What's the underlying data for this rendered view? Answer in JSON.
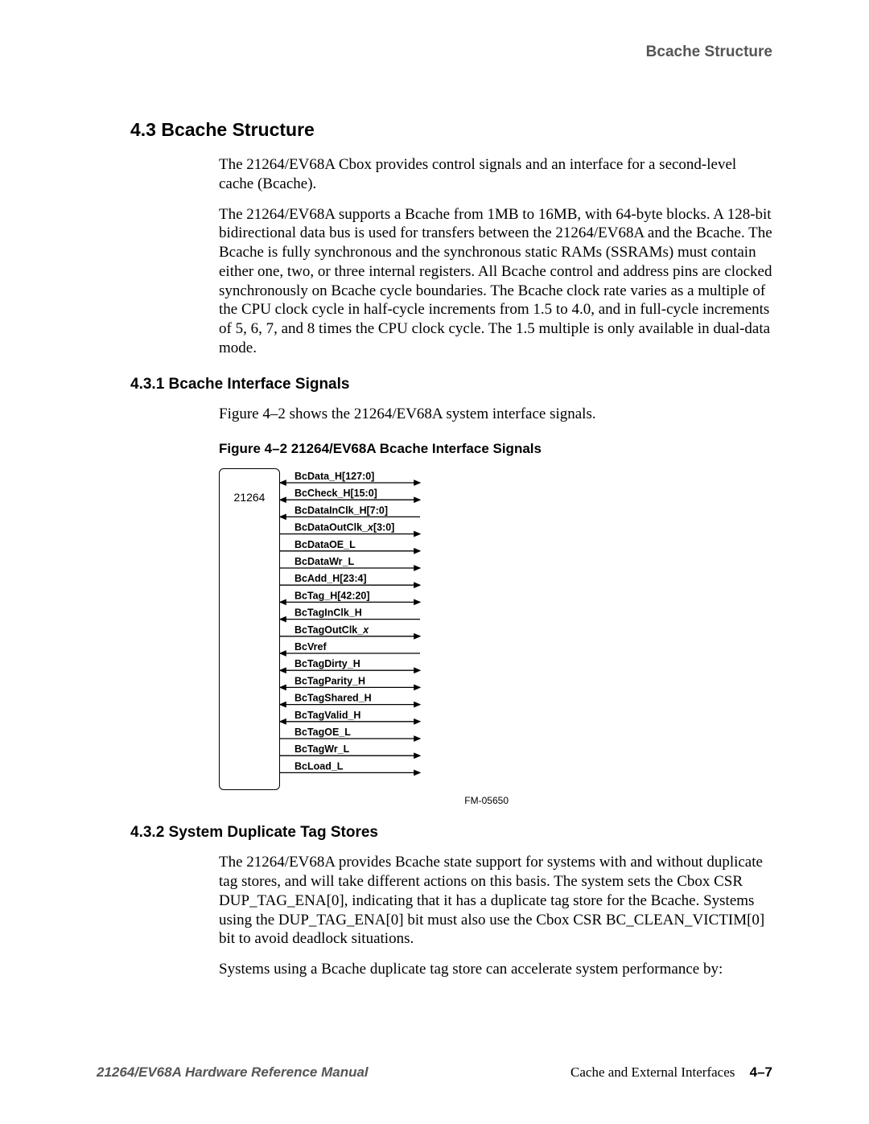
{
  "running_head": "Bcache Structure",
  "section": {
    "number_title": "4.3  Bcache Structure",
    "p1": "The 21264/EV68A Cbox provides control signals and an interface for a second-level cache (Bcache).",
    "p2": "The 21264/EV68A supports a Bcache from 1MB to 16MB, with 64-byte blocks. A 128-bit bidirectional data bus is used for transfers between the 21264/EV68A and the Bcache. The Bcache is fully synchronous and the synchronous static RAMs (SSRAMs) must contain either one, two, or three internal registers. All Bcache control and address pins are clocked synchronously on Bcache cycle boundaries. The Bcache clock rate varies as a multiple of the CPU clock cycle in half-cycle increments from 1.5 to 4.0, and in full-cycle increments of 5, 6, 7, and 8 times the CPU clock cycle. The 1.5 multiple is only available in dual-data mode."
  },
  "sub1": {
    "number_title": "4.3.1  Bcache Interface Signals",
    "p1": "Figure 4–2 shows the 21264/EV68A system interface signals.",
    "fig_caption": "Figure 4–2  21264/EV68A Bcache Interface Signals"
  },
  "figure": {
    "chip_label": "21264",
    "fm_code": "FM-05650",
    "signals": [
      {
        "name": "BcData_H[127:0]",
        "left": true,
        "right": true
      },
      {
        "name": "BcCheck_H[15:0]",
        "left": true,
        "right": true
      },
      {
        "name": "BcDataInClk_H[7:0]",
        "left": true,
        "right": false
      },
      {
        "name": "BcDataOutClk_x[3:0]",
        "left": false,
        "right": true
      },
      {
        "name": "BcDataOE_L",
        "left": false,
        "right": true
      },
      {
        "name": "BcDataWr_L",
        "left": false,
        "right": true
      },
      {
        "name": "BcAdd_H[23:4]",
        "left": false,
        "right": true
      },
      {
        "name": "BcTag_H[42:20]",
        "left": true,
        "right": true
      },
      {
        "name": "BcTagInClk_H",
        "left": true,
        "right": false
      },
      {
        "name": "BcTagOutClk_x",
        "left": false,
        "right": true
      },
      {
        "name": "BcVref",
        "left": true,
        "right": false
      },
      {
        "name": "BcTagDirty_H",
        "left": true,
        "right": true
      },
      {
        "name": "BcTagParity_H",
        "left": true,
        "right": true
      },
      {
        "name": "BcTagShared_H",
        "left": true,
        "right": true
      },
      {
        "name": "BcTagValid_H",
        "left": true,
        "right": true
      },
      {
        "name": "BcTagOE_L",
        "left": false,
        "right": true
      },
      {
        "name": "BcTagWr_L",
        "left": false,
        "right": true
      },
      {
        "name": "BcLoad_L",
        "left": false,
        "right": true
      }
    ]
  },
  "sub2": {
    "number_title": "4.3.2  System Duplicate Tag Stores",
    "p1": "The 21264/EV68A provides Bcache state support for systems with and without duplicate tag stores, and will take different actions on this basis. The system sets the Cbox CSR DUP_TAG_ENA[0], indicating that it has a duplicate tag store for the Bcache. Systems using the DUP_TAG_ENA[0] bit must also use the Cbox CSR BC_CLEAN_VICTIM[0] bit to avoid deadlock situations.",
    "p2": "Systems using a Bcache duplicate tag store can accelerate system performance by:"
  },
  "footer": {
    "left": "21264/EV68A Hardware Reference Manual",
    "right_text": "Cache and External Interfaces",
    "page_num": "4–7"
  }
}
